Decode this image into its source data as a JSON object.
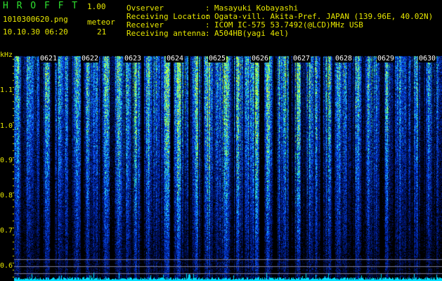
{
  "header": {
    "app_title": "H R O F F T",
    "version": "1.00",
    "filename": "1010300620.png",
    "meteor_label": "meteor",
    "datetime": "10.10.30 06:20",
    "meteor_count": "21",
    "info": [
      {
        "label": "Ovserver",
        "value": "Masayuki Kobayashi"
      },
      {
        "label": "Receiving Location",
        "value": "Ogata-vill. Akita-Pref. JAPAN (139.96E, 40.02N)"
      },
      {
        "label": "Receiver",
        "value": "ICOM IC-575 53.7492(@LCD)MHz USB"
      },
      {
        "label": "Receiving antenna",
        "value": "A504HB(yagi 4el)"
      }
    ]
  },
  "chart_data": {
    "type": "heatmap",
    "ylabel": "kHz",
    "y_ticks": [
      "1.1",
      "1.0",
      "0.9",
      "0.8",
      "0.7",
      "0.6"
    ],
    "x_ticks": [
      "0621",
      "0622",
      "0623",
      "0624",
      "0625",
      "0626",
      "0627",
      "0628",
      "0629",
      "0630"
    ],
    "ylim": [
      0.58,
      1.2
    ],
    "colormap": [
      "#000000",
      "#001060",
      "#0030c0",
      "#1060ff",
      "#20c0ff",
      "#40ffa0",
      "#c0ff40"
    ],
    "grid": false
  }
}
